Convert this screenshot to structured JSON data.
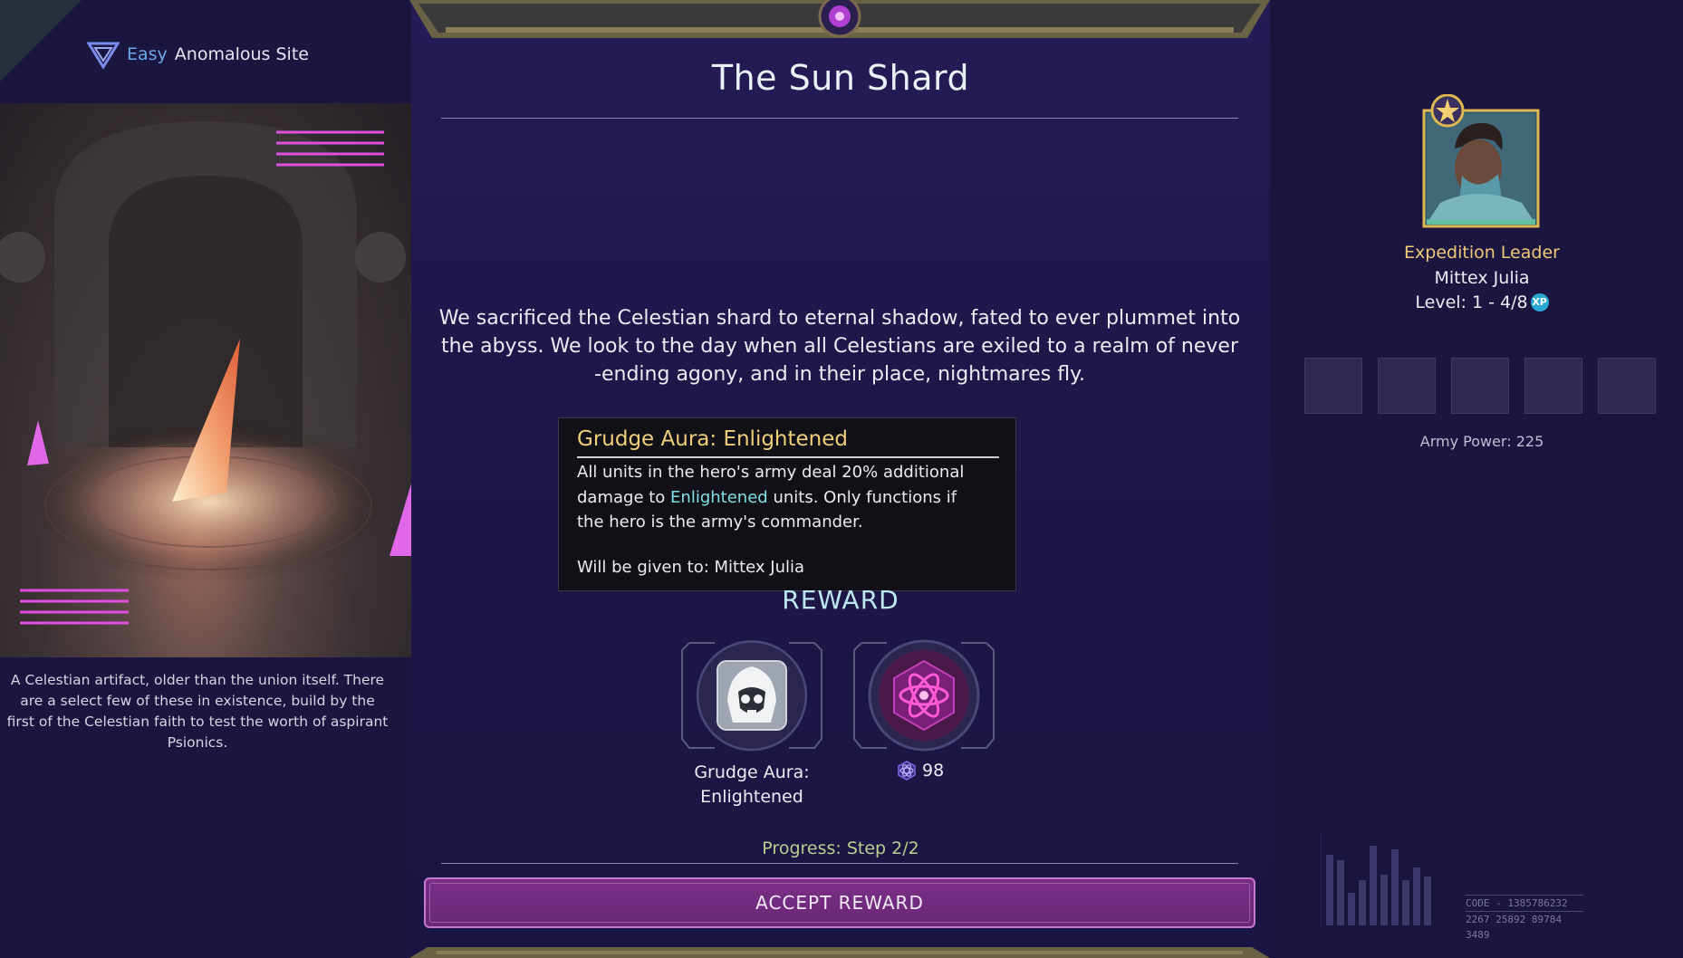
{
  "header": {
    "difficulty": "Easy",
    "site_type": "Anomalous Site"
  },
  "event": {
    "title": "The Sun Shard",
    "story": "We sacrificed the Celestian shard to eternal shadow, fated to ever plummet into the abyss. We look to the day when all Celestians are exiled to a realm of never -ending agony, and in their place, nightmares fly.",
    "image_description": "A Celestian artifact, older than the union itself. There are a select few of these in existence, build by the first of the Celestian faith to test the worth of aspirant Psionics."
  },
  "tooltip": {
    "title": "Grudge Aura: Enlightened",
    "body_part1": "All units in the hero's army deal 20% additional damage to",
    "body_highlight": "Enlightened",
    "body_part2": "units. Only functions if the hero is the army's commander.",
    "given_to": "Will be given to: Mittex Julia"
  },
  "reward": {
    "heading": "REWARD",
    "items": [
      {
        "icon": "hooded-skull-icon",
        "label_line1": "Grudge Aura:",
        "label_line2": "Enlightened"
      },
      {
        "icon": "atom-icon",
        "amount": "98"
      }
    ]
  },
  "progress": "Progress: Step 2/2",
  "accept_button": "ACCEPT REWARD",
  "hero": {
    "role": "Expedition Leader",
    "name": "Mittex Julia",
    "level": "Level: 1 - 4/8",
    "xp_badge": "XP",
    "army_power": "Army Power: 225"
  },
  "code": {
    "line1": "CODE - 1385786232",
    "line2": "2267 25892 89784 3489"
  },
  "colors": {
    "accent_gold": "#f0c878",
    "accent_cyan": "#7fe0e6",
    "button_purple": "#7a2f87"
  }
}
